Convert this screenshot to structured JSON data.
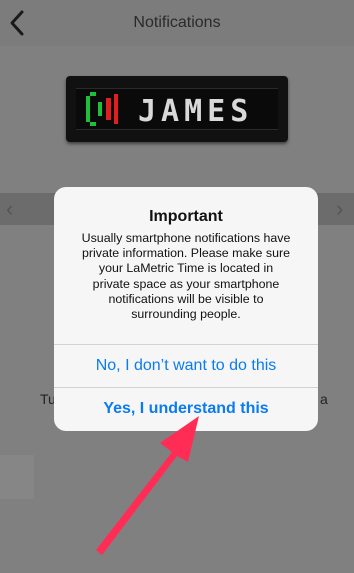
{
  "navbar": {
    "title": "Notifications"
  },
  "device": {
    "display_text": "JAMES"
  },
  "background": {
    "left_fragment": "Tu",
    "right_fragment": "a"
  },
  "dialog": {
    "title": "Important",
    "message_lines": [
      "Usually smartphone notifications have",
      "private information. Please make sure",
      "your LaMetric Time is located in",
      "private space as your smartphone",
      "notifications will be visible to",
      "surrounding people."
    ],
    "decline_label": "No, I don’t want to do this",
    "accept_label": "Yes, I understand this"
  },
  "colors": {
    "accent": "#0a7cf0",
    "annotation_arrow": "#ff2d55"
  }
}
